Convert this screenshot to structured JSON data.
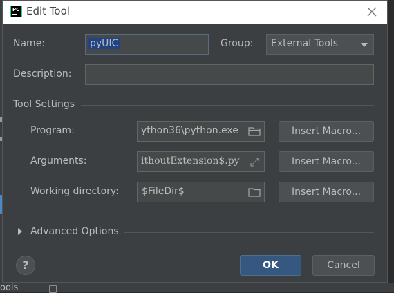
{
  "window": {
    "title": "Edit Tool",
    "app_icon_text": "PC"
  },
  "form": {
    "name_label": "Name:",
    "name_value": "pyUIC",
    "group_label": "Group:",
    "group_value": "External Tools",
    "description_label": "Description:",
    "description_value": ""
  },
  "tool_settings": {
    "section_label": "Tool Settings",
    "program_label": "Program:",
    "program_value": "ython36\\python.exe",
    "arguments_label": "Arguments:",
    "arguments_value": "ithoutExtension$.py",
    "working_dir_label": "Working directory:",
    "working_dir_value": "$FileDir$",
    "insert_macro_label": "Insert Macro..."
  },
  "advanced": {
    "label": "Advanced Options"
  },
  "footer": {
    "help_label": "?",
    "ok_label": "OK",
    "cancel_label": "Cancel"
  },
  "background": {
    "bottom_text": "ools"
  },
  "colors": {
    "dialog_bg": "#3c3f41",
    "field_bg": "#45494a",
    "primary_button": "#365880",
    "selection": "#214283",
    "text": "#bbbbbb"
  },
  "icons": {
    "close": "close-icon",
    "folder": "folder-icon",
    "expand": "expand-icon",
    "chevron": "chevron-down-icon",
    "triangle_right": "triangle-right-icon",
    "help": "help-icon"
  }
}
